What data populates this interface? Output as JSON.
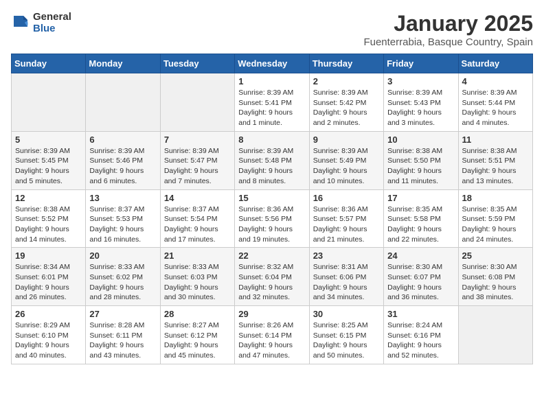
{
  "header": {
    "logo_line1": "General",
    "logo_line2": "Blue",
    "title": "January 2025",
    "subtitle": "Fuenterrabia, Basque Country, Spain"
  },
  "columns": [
    "Sunday",
    "Monday",
    "Tuesday",
    "Wednesday",
    "Thursday",
    "Friday",
    "Saturday"
  ],
  "weeks": [
    [
      {
        "day": "",
        "info": ""
      },
      {
        "day": "",
        "info": ""
      },
      {
        "day": "",
        "info": ""
      },
      {
        "day": "1",
        "info": "Sunrise: 8:39 AM\nSunset: 5:41 PM\nDaylight: 9 hours\nand 1 minute."
      },
      {
        "day": "2",
        "info": "Sunrise: 8:39 AM\nSunset: 5:42 PM\nDaylight: 9 hours\nand 2 minutes."
      },
      {
        "day": "3",
        "info": "Sunrise: 8:39 AM\nSunset: 5:43 PM\nDaylight: 9 hours\nand 3 minutes."
      },
      {
        "day": "4",
        "info": "Sunrise: 8:39 AM\nSunset: 5:44 PM\nDaylight: 9 hours\nand 4 minutes."
      }
    ],
    [
      {
        "day": "5",
        "info": "Sunrise: 8:39 AM\nSunset: 5:45 PM\nDaylight: 9 hours\nand 5 minutes."
      },
      {
        "day": "6",
        "info": "Sunrise: 8:39 AM\nSunset: 5:46 PM\nDaylight: 9 hours\nand 6 minutes."
      },
      {
        "day": "7",
        "info": "Sunrise: 8:39 AM\nSunset: 5:47 PM\nDaylight: 9 hours\nand 7 minutes."
      },
      {
        "day": "8",
        "info": "Sunrise: 8:39 AM\nSunset: 5:48 PM\nDaylight: 9 hours\nand 8 minutes."
      },
      {
        "day": "9",
        "info": "Sunrise: 8:39 AM\nSunset: 5:49 PM\nDaylight: 9 hours\nand 10 minutes."
      },
      {
        "day": "10",
        "info": "Sunrise: 8:38 AM\nSunset: 5:50 PM\nDaylight: 9 hours\nand 11 minutes."
      },
      {
        "day": "11",
        "info": "Sunrise: 8:38 AM\nSunset: 5:51 PM\nDaylight: 9 hours\nand 13 minutes."
      }
    ],
    [
      {
        "day": "12",
        "info": "Sunrise: 8:38 AM\nSunset: 5:52 PM\nDaylight: 9 hours\nand 14 minutes."
      },
      {
        "day": "13",
        "info": "Sunrise: 8:37 AM\nSunset: 5:53 PM\nDaylight: 9 hours\nand 16 minutes."
      },
      {
        "day": "14",
        "info": "Sunrise: 8:37 AM\nSunset: 5:54 PM\nDaylight: 9 hours\nand 17 minutes."
      },
      {
        "day": "15",
        "info": "Sunrise: 8:36 AM\nSunset: 5:56 PM\nDaylight: 9 hours\nand 19 minutes."
      },
      {
        "day": "16",
        "info": "Sunrise: 8:36 AM\nSunset: 5:57 PM\nDaylight: 9 hours\nand 21 minutes."
      },
      {
        "day": "17",
        "info": "Sunrise: 8:35 AM\nSunset: 5:58 PM\nDaylight: 9 hours\nand 22 minutes."
      },
      {
        "day": "18",
        "info": "Sunrise: 8:35 AM\nSunset: 5:59 PM\nDaylight: 9 hours\nand 24 minutes."
      }
    ],
    [
      {
        "day": "19",
        "info": "Sunrise: 8:34 AM\nSunset: 6:01 PM\nDaylight: 9 hours\nand 26 minutes."
      },
      {
        "day": "20",
        "info": "Sunrise: 8:33 AM\nSunset: 6:02 PM\nDaylight: 9 hours\nand 28 minutes."
      },
      {
        "day": "21",
        "info": "Sunrise: 8:33 AM\nSunset: 6:03 PM\nDaylight: 9 hours\nand 30 minutes."
      },
      {
        "day": "22",
        "info": "Sunrise: 8:32 AM\nSunset: 6:04 PM\nDaylight: 9 hours\nand 32 minutes."
      },
      {
        "day": "23",
        "info": "Sunrise: 8:31 AM\nSunset: 6:06 PM\nDaylight: 9 hours\nand 34 minutes."
      },
      {
        "day": "24",
        "info": "Sunrise: 8:30 AM\nSunset: 6:07 PM\nDaylight: 9 hours\nand 36 minutes."
      },
      {
        "day": "25",
        "info": "Sunrise: 8:30 AM\nSunset: 6:08 PM\nDaylight: 9 hours\nand 38 minutes."
      }
    ],
    [
      {
        "day": "26",
        "info": "Sunrise: 8:29 AM\nSunset: 6:10 PM\nDaylight: 9 hours\nand 40 minutes."
      },
      {
        "day": "27",
        "info": "Sunrise: 8:28 AM\nSunset: 6:11 PM\nDaylight: 9 hours\nand 43 minutes."
      },
      {
        "day": "28",
        "info": "Sunrise: 8:27 AM\nSunset: 6:12 PM\nDaylight: 9 hours\nand 45 minutes."
      },
      {
        "day": "29",
        "info": "Sunrise: 8:26 AM\nSunset: 6:14 PM\nDaylight: 9 hours\nand 47 minutes."
      },
      {
        "day": "30",
        "info": "Sunrise: 8:25 AM\nSunset: 6:15 PM\nDaylight: 9 hours\nand 50 minutes."
      },
      {
        "day": "31",
        "info": "Sunrise: 8:24 AM\nSunset: 6:16 PM\nDaylight: 9 hours\nand 52 minutes."
      },
      {
        "day": "",
        "info": ""
      }
    ]
  ]
}
